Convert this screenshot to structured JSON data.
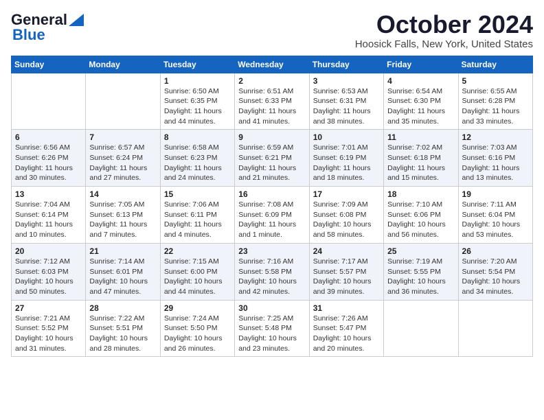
{
  "header": {
    "logo_line1": "General",
    "logo_line2": "Blue",
    "title": "October 2024",
    "subtitle": "Hoosick Falls, New York, United States"
  },
  "weekdays": [
    "Sunday",
    "Monday",
    "Tuesday",
    "Wednesday",
    "Thursday",
    "Friday",
    "Saturday"
  ],
  "weeks": [
    [
      {
        "day": "",
        "detail": ""
      },
      {
        "day": "",
        "detail": ""
      },
      {
        "day": "1",
        "detail": "Sunrise: 6:50 AM\nSunset: 6:35 PM\nDaylight: 11 hours and 44 minutes."
      },
      {
        "day": "2",
        "detail": "Sunrise: 6:51 AM\nSunset: 6:33 PM\nDaylight: 11 hours and 41 minutes."
      },
      {
        "day": "3",
        "detail": "Sunrise: 6:53 AM\nSunset: 6:31 PM\nDaylight: 11 hours and 38 minutes."
      },
      {
        "day": "4",
        "detail": "Sunrise: 6:54 AM\nSunset: 6:30 PM\nDaylight: 11 hours and 35 minutes."
      },
      {
        "day": "5",
        "detail": "Sunrise: 6:55 AM\nSunset: 6:28 PM\nDaylight: 11 hours and 33 minutes."
      }
    ],
    [
      {
        "day": "6",
        "detail": "Sunrise: 6:56 AM\nSunset: 6:26 PM\nDaylight: 11 hours and 30 minutes."
      },
      {
        "day": "7",
        "detail": "Sunrise: 6:57 AM\nSunset: 6:24 PM\nDaylight: 11 hours and 27 minutes."
      },
      {
        "day": "8",
        "detail": "Sunrise: 6:58 AM\nSunset: 6:23 PM\nDaylight: 11 hours and 24 minutes."
      },
      {
        "day": "9",
        "detail": "Sunrise: 6:59 AM\nSunset: 6:21 PM\nDaylight: 11 hours and 21 minutes."
      },
      {
        "day": "10",
        "detail": "Sunrise: 7:01 AM\nSunset: 6:19 PM\nDaylight: 11 hours and 18 minutes."
      },
      {
        "day": "11",
        "detail": "Sunrise: 7:02 AM\nSunset: 6:18 PM\nDaylight: 11 hours and 15 minutes."
      },
      {
        "day": "12",
        "detail": "Sunrise: 7:03 AM\nSunset: 6:16 PM\nDaylight: 11 hours and 13 minutes."
      }
    ],
    [
      {
        "day": "13",
        "detail": "Sunrise: 7:04 AM\nSunset: 6:14 PM\nDaylight: 11 hours and 10 minutes."
      },
      {
        "day": "14",
        "detail": "Sunrise: 7:05 AM\nSunset: 6:13 PM\nDaylight: 11 hours and 7 minutes."
      },
      {
        "day": "15",
        "detail": "Sunrise: 7:06 AM\nSunset: 6:11 PM\nDaylight: 11 hours and 4 minutes."
      },
      {
        "day": "16",
        "detail": "Sunrise: 7:08 AM\nSunset: 6:09 PM\nDaylight: 11 hours and 1 minute."
      },
      {
        "day": "17",
        "detail": "Sunrise: 7:09 AM\nSunset: 6:08 PM\nDaylight: 10 hours and 58 minutes."
      },
      {
        "day": "18",
        "detail": "Sunrise: 7:10 AM\nSunset: 6:06 PM\nDaylight: 10 hours and 56 minutes."
      },
      {
        "day": "19",
        "detail": "Sunrise: 7:11 AM\nSunset: 6:04 PM\nDaylight: 10 hours and 53 minutes."
      }
    ],
    [
      {
        "day": "20",
        "detail": "Sunrise: 7:12 AM\nSunset: 6:03 PM\nDaylight: 10 hours and 50 minutes."
      },
      {
        "day": "21",
        "detail": "Sunrise: 7:14 AM\nSunset: 6:01 PM\nDaylight: 10 hours and 47 minutes."
      },
      {
        "day": "22",
        "detail": "Sunrise: 7:15 AM\nSunset: 6:00 PM\nDaylight: 10 hours and 44 minutes."
      },
      {
        "day": "23",
        "detail": "Sunrise: 7:16 AM\nSunset: 5:58 PM\nDaylight: 10 hours and 42 minutes."
      },
      {
        "day": "24",
        "detail": "Sunrise: 7:17 AM\nSunset: 5:57 PM\nDaylight: 10 hours and 39 minutes."
      },
      {
        "day": "25",
        "detail": "Sunrise: 7:19 AM\nSunset: 5:55 PM\nDaylight: 10 hours and 36 minutes."
      },
      {
        "day": "26",
        "detail": "Sunrise: 7:20 AM\nSunset: 5:54 PM\nDaylight: 10 hours and 34 minutes."
      }
    ],
    [
      {
        "day": "27",
        "detail": "Sunrise: 7:21 AM\nSunset: 5:52 PM\nDaylight: 10 hours and 31 minutes."
      },
      {
        "day": "28",
        "detail": "Sunrise: 7:22 AM\nSunset: 5:51 PM\nDaylight: 10 hours and 28 minutes."
      },
      {
        "day": "29",
        "detail": "Sunrise: 7:24 AM\nSunset: 5:50 PM\nDaylight: 10 hours and 26 minutes."
      },
      {
        "day": "30",
        "detail": "Sunrise: 7:25 AM\nSunset: 5:48 PM\nDaylight: 10 hours and 23 minutes."
      },
      {
        "day": "31",
        "detail": "Sunrise: 7:26 AM\nSunset: 5:47 PM\nDaylight: 10 hours and 20 minutes."
      },
      {
        "day": "",
        "detail": ""
      },
      {
        "day": "",
        "detail": ""
      }
    ]
  ]
}
